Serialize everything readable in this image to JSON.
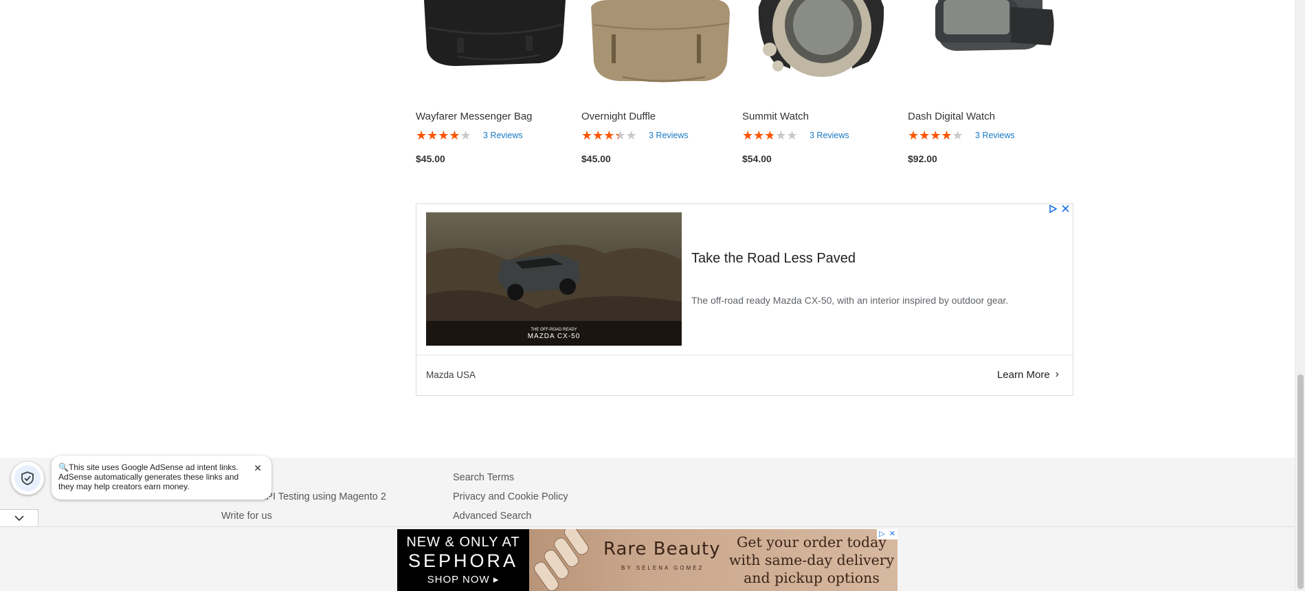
{
  "products": [
    {
      "name": "Wayfarer Messenger Bag",
      "rating": 0.7,
      "reviews": "3 Reviews",
      "price": "$45.00",
      "image": "messenger-bag-image"
    },
    {
      "name": "Overnight Duffle",
      "rating": 0.6,
      "reviews": "3 Reviews",
      "price": "$45.00",
      "image": "duffle-bag-image"
    },
    {
      "name": "Summit Watch",
      "rating": 0.5,
      "reviews": "3 Reviews",
      "price": "$54.00",
      "image": "summit-watch-image"
    },
    {
      "name": "Dash Digital Watch",
      "rating": 0.7,
      "reviews": "3 Reviews",
      "price": "$92.00",
      "image": "dash-watch-image"
    }
  ],
  "ad": {
    "headline": "Take the Road Less Paved",
    "body": "The off-road ready Mazda CX-50, with an interior inspired by outdoor gear.",
    "advertiser": "Mazda USA",
    "cta": "Learn More",
    "image_caption_line1": "THE OFF-ROAD READY",
    "image_caption_line2": "MAZDA CX-50"
  },
  "footer": {
    "col1": [
      "Practice API Testing using Magento 2",
      "Write for us"
    ],
    "col2": [
      "Search Terms",
      "Privacy and Cookie Policy",
      "Advanced Search"
    ]
  },
  "notice": {
    "text": "This site uses Google AdSense ad intent links. AdSense automatically generates these links and they may help creators earn money."
  },
  "banner": {
    "line1": "NEW & ONLY AT",
    "line2": "SEPHORA",
    "line3": "SHOP NOW ▸",
    "brand": "Rare Beauty",
    "brand_sub": "BY SELENA GOMEZ",
    "copy": "Get your order today with same-day delivery and pickup options"
  },
  "colors": {
    "star_filled": "#ff5501",
    "star_empty": "#c8c8c8",
    "link": "#1979c3",
    "footer_bg": "#f4f4f4"
  }
}
